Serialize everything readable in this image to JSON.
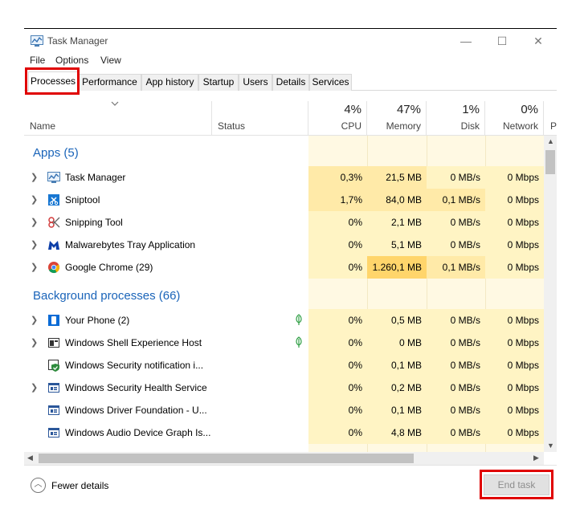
{
  "window": {
    "title": "Task Manager",
    "controls": [
      "—",
      "☐",
      "✕"
    ]
  },
  "menu": [
    "File",
    "Options",
    "View"
  ],
  "tabs": [
    {
      "label": "Processes",
      "active": true
    },
    {
      "label": "Performance"
    },
    {
      "label": "App history"
    },
    {
      "label": "Startup"
    },
    {
      "label": "Users"
    },
    {
      "label": "Details"
    },
    {
      "label": "Services"
    }
  ],
  "columns": {
    "name": "Name",
    "status": "Status",
    "cpu": {
      "pct": "4%",
      "label": "CPU"
    },
    "memory": {
      "pct": "47%",
      "label": "Memory"
    },
    "disk": {
      "pct": "1%",
      "label": "Disk"
    },
    "network": {
      "pct": "0%",
      "label": "Network"
    },
    "power_cut": "P"
  },
  "groups": {
    "apps": "Apps (5)",
    "background": "Background processes (66)"
  },
  "apps": [
    {
      "name": "Task Manager",
      "cpu": "0,3%",
      "memory": "21,5 MB",
      "disk": "0 MB/s",
      "network": "0 Mbps",
      "icon": "task-manager-icon"
    },
    {
      "name": "Sniptool",
      "cpu": "1,7%",
      "memory": "84,0 MB",
      "disk": "0,1 MB/s",
      "network": "0 Mbps",
      "icon": "sniptool-icon"
    },
    {
      "name": "Snipping Tool",
      "cpu": "0%",
      "memory": "2,1 MB",
      "disk": "0 MB/s",
      "network": "0 Mbps",
      "icon": "snipping-tool-icon"
    },
    {
      "name": "Malwarebytes Tray Application",
      "cpu": "0%",
      "memory": "5,1 MB",
      "disk": "0 MB/s",
      "network": "0 Mbps",
      "icon": "malwarebytes-icon"
    },
    {
      "name": "Google Chrome (29)",
      "cpu": "0%",
      "memory": "1.260,1 MB",
      "disk": "0,1 MB/s",
      "network": "0 Mbps",
      "icon": "chrome-icon"
    }
  ],
  "background": [
    {
      "name": "Your Phone (2)",
      "cpu": "0%",
      "memory": "0,5 MB",
      "disk": "0 MB/s",
      "network": "0 Mbps",
      "icon": "your-phone-icon"
    },
    {
      "name": "Windows Shell Experience Host",
      "cpu": "0%",
      "memory": "0 MB",
      "disk": "0 MB/s",
      "network": "0 Mbps",
      "icon": "shell-host-icon"
    },
    {
      "name": "Windows Security notification i...",
      "cpu": "0%",
      "memory": "0,1 MB",
      "disk": "0 MB/s",
      "network": "0 Mbps",
      "icon": "security-shield-icon"
    },
    {
      "name": "Windows Security Health Service",
      "cpu": "0%",
      "memory": "0,2 MB",
      "disk": "0 MB/s",
      "network": "0 Mbps",
      "icon": "service-window-icon"
    },
    {
      "name": "Windows Driver Foundation - U...",
      "cpu": "0%",
      "memory": "0,1 MB",
      "disk": "0 MB/s",
      "network": "0 Mbps",
      "icon": "service-window-icon"
    },
    {
      "name": "Windows Audio Device Graph Is...",
      "cpu": "0%",
      "memory": "4,8 MB",
      "disk": "0 MB/s",
      "network": "0 Mbps",
      "icon": "service-window-icon"
    }
  ],
  "footer": {
    "fewer_details": "Fewer details",
    "end_task": "End task"
  },
  "colors": {
    "heat_low": "#fff4c4",
    "heat_mid": "#ffeaa8",
    "heat_high": "#ffd56b",
    "band": "#fff9e3",
    "accent": "#1a64b9",
    "highlight": "#e00000"
  }
}
